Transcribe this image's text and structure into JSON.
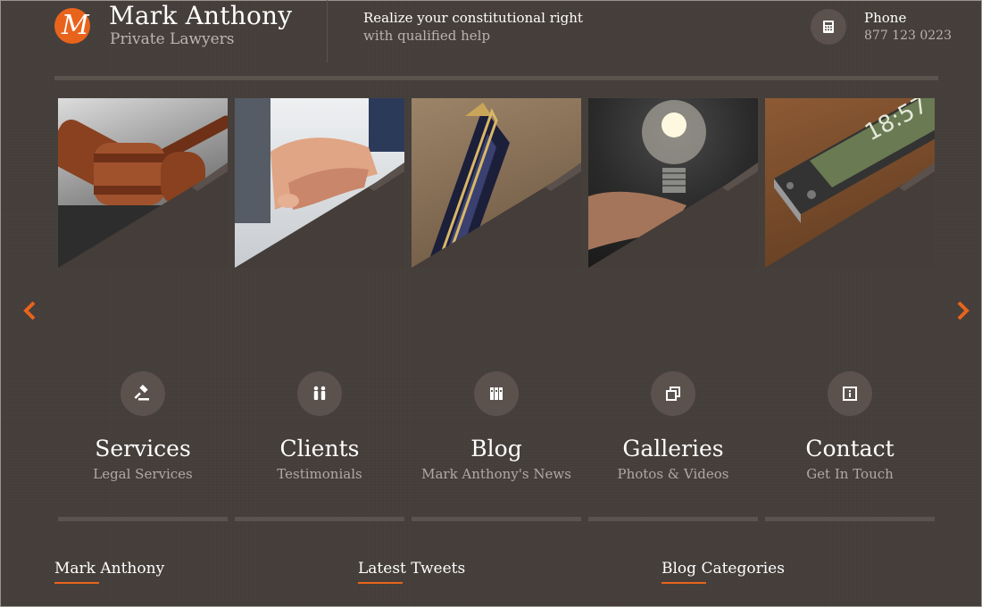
{
  "header": {
    "logo_letter": "M",
    "brand_name": "Mark Anthony",
    "brand_sub": "Private Lawyers",
    "tagline_line1": "Realize your constitutional right",
    "tagline_line2": "with qualified help",
    "phone_label": "Phone",
    "phone_number": "877 123 0223"
  },
  "slider": {
    "images": [
      "gavel",
      "handshake",
      "fountain-pen",
      "lightbulb",
      "smartphone"
    ]
  },
  "features": [
    {
      "title": "Services",
      "subtitle": "Legal Services",
      "icon": "gavel-icon"
    },
    {
      "title": "Clients",
      "subtitle": "Testimonials",
      "icon": "people-icon"
    },
    {
      "title": "Blog",
      "subtitle": "Mark Anthony's News",
      "icon": "books-icon"
    },
    {
      "title": "Galleries",
      "subtitle": "Photos & Videos",
      "icon": "gallery-icon"
    },
    {
      "title": "Contact",
      "subtitle": "Get In Touch",
      "icon": "info-icon"
    }
  ],
  "footer": {
    "col1": "Mark Anthony",
    "col2": "Latest Tweets",
    "col3": "Blog Categories"
  },
  "colors": {
    "accent": "#e8641c",
    "background": "#443d39"
  }
}
